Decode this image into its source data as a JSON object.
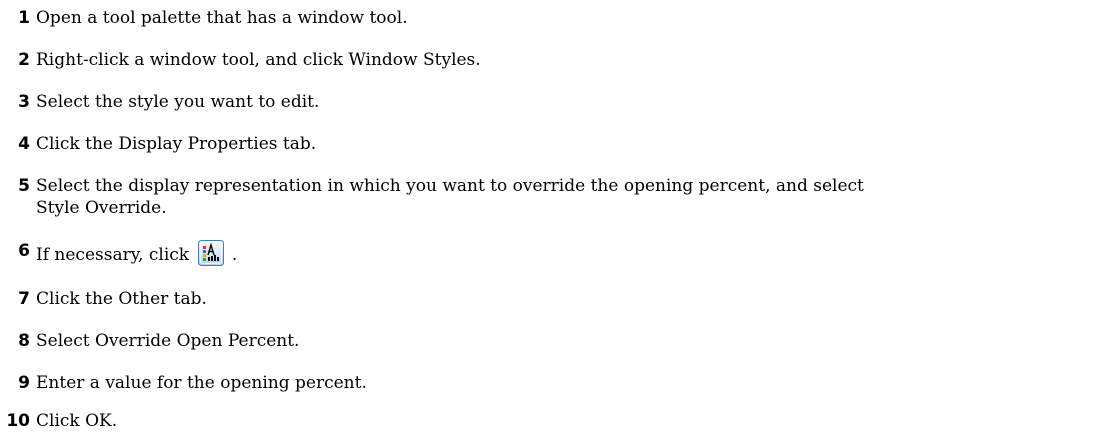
{
  "steps": [
    {
      "number": "1",
      "text": "Open a tool palette that has a window tool."
    },
    {
      "number": "2",
      "text": "Right-click a window tool, and click Window Styles."
    },
    {
      "number": "3",
      "text": "Select the style you want to edit."
    },
    {
      "number": "4",
      "text": "Click the Display Properties tab."
    },
    {
      "number": "5",
      "line1": "Select the display representation in which you want to override the opening percent, and select",
      "line2": "Style Override."
    },
    {
      "number": "6",
      "text_before": "If necessary, click",
      "text_after": ".",
      "icon": "display-properties-edit-icon"
    },
    {
      "number": "7",
      "text": "Click the Other tab."
    },
    {
      "number": "8",
      "text": "Select Override Open Percent."
    },
    {
      "number": "9",
      "text": "Enter a value for the opening percent."
    },
    {
      "number": "10",
      "text": "Click OK."
    }
  ]
}
